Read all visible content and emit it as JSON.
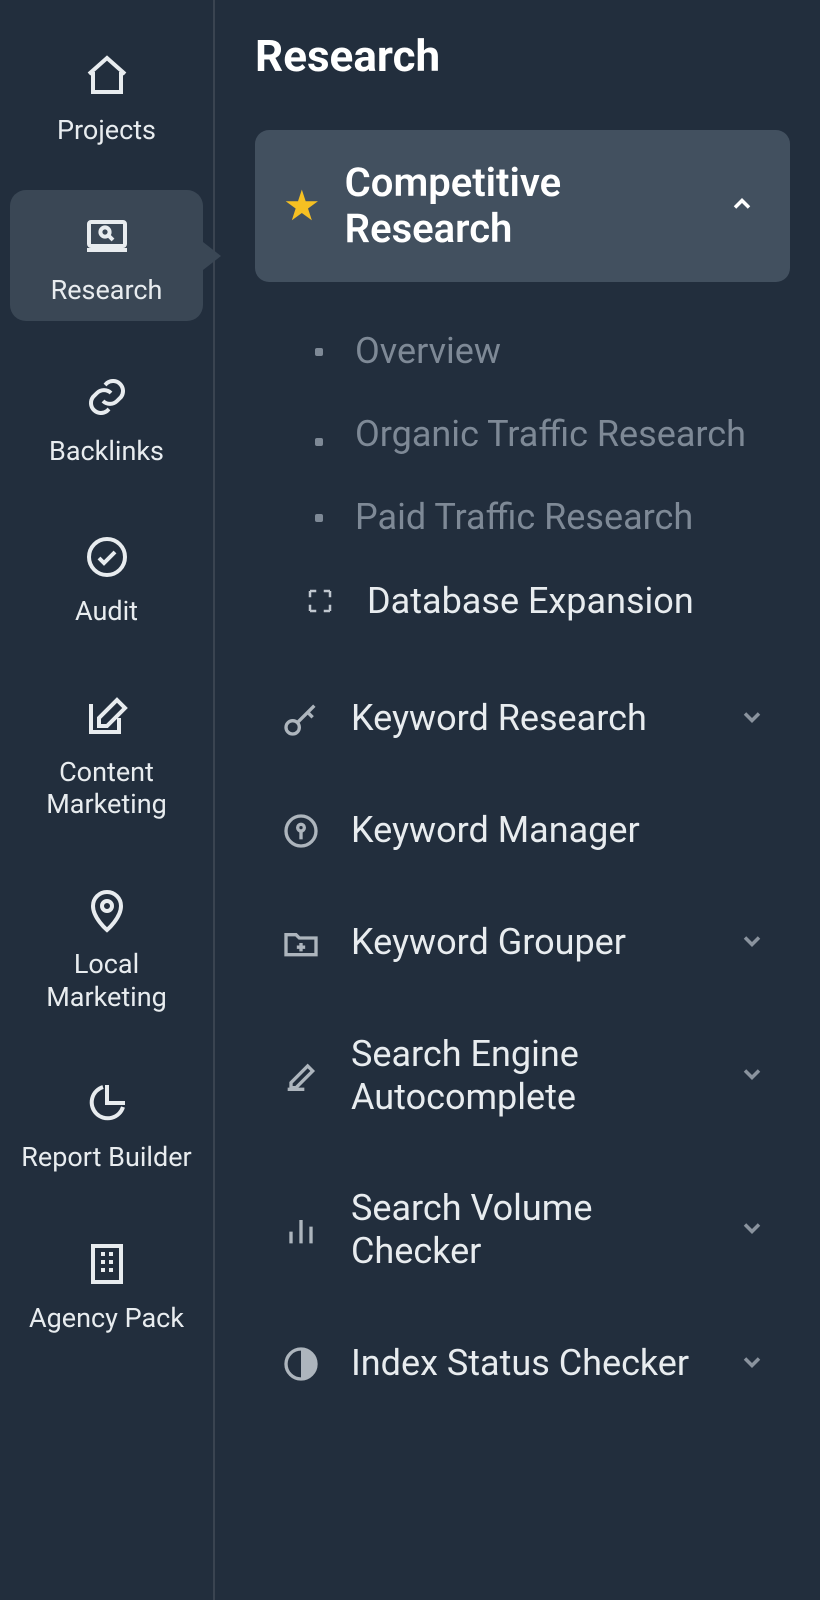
{
  "nav": {
    "items": [
      {
        "label": "Projects"
      },
      {
        "label": "Research"
      },
      {
        "label": "Backlinks"
      },
      {
        "label": "Audit"
      },
      {
        "label": "Content Marketing"
      },
      {
        "label": "Local Marketing"
      },
      {
        "label": "Report Builder"
      },
      {
        "label": "Agency Pack"
      }
    ]
  },
  "main": {
    "title": "Research",
    "featured": {
      "label": "Competitive Research"
    },
    "sub": [
      {
        "label": "Overview"
      },
      {
        "label": "Organic Traffic Research"
      },
      {
        "label": "Paid Traffic Research"
      },
      {
        "label": "Database Expansion"
      }
    ],
    "sections": [
      {
        "label": "Keyword Research"
      },
      {
        "label": "Keyword Manager"
      },
      {
        "label": "Keyword Grouper"
      },
      {
        "label": "Search Engine Autocomplete"
      },
      {
        "label": "Search Volume Checker"
      },
      {
        "label": "Index Status Checker"
      }
    ]
  }
}
